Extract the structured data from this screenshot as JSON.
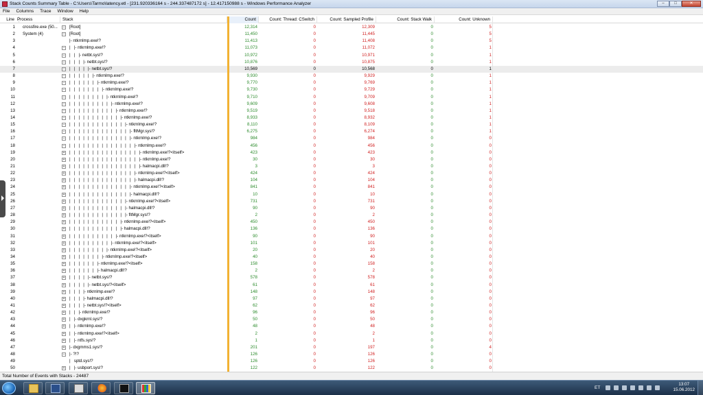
{
  "window": {
    "title": "Stack Counts Summary Table - C:\\Users\\Tarmo\\latency.etl - [231.920336164 s - 244.337487172 s] - 12.417150988 s - Windows Performance Analyzer",
    "minimize": "–",
    "maximize": "□",
    "close": "✕"
  },
  "menu": [
    "File",
    "Columns",
    "Trace",
    "Window",
    "Help"
  ],
  "columns": {
    "line": "Line",
    "process": "Process",
    "stack": "Stack",
    "count": "Count",
    "count_cswitch": "Count: Thread: CSwitch",
    "count_sampled": "Count: Sampled Profile",
    "count_stackwalk": "Count: Stack Walk",
    "count_unknown": "Count: Unknown"
  },
  "rows": [
    {
      "line": "1",
      "proc": "crossfire.exe (50...",
      "exp": "⊟",
      "stack": "[Root]",
      "count": "12,314",
      "cs": "0",
      "sp": "12,309",
      "sw": "0",
      "unk": "5"
    },
    {
      "line": "2",
      "proc": "System (4)",
      "exp": "⊟",
      "stack": "[Root]",
      "count": "11,450",
      "cs": "0",
      "sp": "11,445",
      "sw": "0",
      "unk": "5"
    },
    {
      "line": "3",
      "proc": "",
      "exp": "",
      "stack": "|- ntkrnlmp.exe!?",
      "count": "11,413",
      "cs": "0",
      "sp": "11,408",
      "sw": "0",
      "unk": "5"
    },
    {
      "line": "4",
      "proc": "",
      "exp": "⊟",
      "stack": "|   |- ntkrnlmp.exe!?",
      "count": "11,073",
      "cs": "0",
      "sp": "11,072",
      "sw": "0",
      "unk": "1"
    },
    {
      "line": "5",
      "proc": "",
      "exp": "⊟",
      "stack": "|   |   |- netbt.sys!?",
      "count": "10,972",
      "cs": "0",
      "sp": "10,971",
      "sw": "0",
      "unk": "1"
    },
    {
      "line": "6",
      "proc": "",
      "exp": "⊟",
      "stack": "|   |   |   |- netbt.sys!?",
      "count": "10,876",
      "cs": "0",
      "sp": "10,875",
      "sw": "0",
      "unk": "1"
    },
    {
      "line": "7",
      "proc": "",
      "exp": "⊟",
      "stack": "|   |   |   |   |- netbt.sys!?",
      "count": "10,569",
      "cs": "0",
      "sp": "10,568",
      "sw": "0",
      "unk": "1"
    },
    {
      "line": "8",
      "proc": "",
      "exp": "⊟",
      "stack": "|   |   |   |   |   |- ntkrnlmp.exe!?",
      "count": "9,930",
      "cs": "0",
      "sp": "9,929",
      "sw": "0",
      "unk": "1"
    },
    {
      "line": "9",
      "proc": "",
      "exp": "⊟",
      "stack": "|   |   |   |   |   |   |- ntkrnlmp.exe!?",
      "count": "9,770",
      "cs": "0",
      "sp": "9,769",
      "sw": "0",
      "unk": "1"
    },
    {
      "line": "10",
      "proc": "",
      "exp": "⊟",
      "stack": "|   |   |   |   |   |   |   |- ntkrnlmp.exe!?",
      "count": "9,730",
      "cs": "0",
      "sp": "9,729",
      "sw": "0",
      "unk": "1"
    },
    {
      "line": "11",
      "proc": "",
      "exp": "⊟",
      "stack": "|   |   |   |   |   |   |   |   |- ntkrnlmp.exe!?",
      "count": "9,710",
      "cs": "0",
      "sp": "9,709",
      "sw": "0",
      "unk": "1"
    },
    {
      "line": "12",
      "proc": "",
      "exp": "⊟",
      "stack": "|   |   |   |   |   |   |   |   |   |- ntkrnlmp.exe!?",
      "count": "9,609",
      "cs": "0",
      "sp": "9,608",
      "sw": "0",
      "unk": "1"
    },
    {
      "line": "13",
      "proc": "",
      "exp": "⊟",
      "stack": "|   |   |   |   |   |   |   |   |   |   |- ntkrnlmp.exe!?",
      "count": "9,519",
      "cs": "0",
      "sp": "9,518",
      "sw": "0",
      "unk": "1"
    },
    {
      "line": "14",
      "proc": "",
      "exp": "⊟",
      "stack": "|   |   |   |   |   |   |   |   |   |   |   |- ntkrnlmp.exe!?",
      "count": "8,933",
      "cs": "0",
      "sp": "8,932",
      "sw": "0",
      "unk": "1"
    },
    {
      "line": "15",
      "proc": "",
      "exp": "⊟",
      "stack": "|   |   |   |   |   |   |   |   |   |   |   |   |- ntkrnlmp.exe!?",
      "count": "8,110",
      "cs": "0",
      "sp": "8,109",
      "sw": "0",
      "unk": "1"
    },
    {
      "line": "16",
      "proc": "",
      "exp": "⊟",
      "stack": "|   |   |   |   |   |   |   |   |   |   |   |   |   |- fltMgr.sys!?",
      "count": "6,275",
      "cs": "0",
      "sp": "6,274",
      "sw": "0",
      "unk": "1"
    },
    {
      "line": "17",
      "proc": "",
      "exp": "⊟",
      "stack": "|   |   |   |   |   |   |   |   |   |   |   |   |   |- ntkrnlmp.exe!?",
      "count": "984",
      "cs": "0",
      "sp": "984",
      "sw": "0",
      "unk": "0"
    },
    {
      "line": "18",
      "proc": "",
      "exp": "⊟",
      "stack": "|   |   |   |   |   |   |   |   |   |   |   |   |   |   |- ntkrnlmp.exe!?",
      "count": "456",
      "cs": "0",
      "sp": "456",
      "sw": "0",
      "unk": "0"
    },
    {
      "line": "19",
      "proc": "",
      "exp": "⊞",
      "stack": "|   |   |   |   |   |   |   |   |   |   |   |   |   |   |   |- ntkrnlmp.exe!?<itself>",
      "count": "423",
      "cs": "0",
      "sp": "423",
      "sw": "0",
      "unk": "0"
    },
    {
      "line": "20",
      "proc": "",
      "exp": "⊞",
      "stack": "|   |   |   |   |   |   |   |   |   |   |   |   |   |   |   |- ntkrnlmp.exe!?",
      "count": "30",
      "cs": "0",
      "sp": "30",
      "sw": "0",
      "unk": "0"
    },
    {
      "line": "21",
      "proc": "",
      "exp": "⊞",
      "stack": "|   |   |   |   |   |   |   |   |   |   |   |   |   |   |   |- halmacpi.dll!?",
      "count": "3",
      "cs": "0",
      "sp": "3",
      "sw": "0",
      "unk": "0"
    },
    {
      "line": "22",
      "proc": "",
      "exp": "⊞",
      "stack": "|   |   |   |   |   |   |   |   |   |   |   |   |   |   |- ntkrnlmp.exe!?<itself>",
      "count": "424",
      "cs": "0",
      "sp": "424",
      "sw": "0",
      "unk": "0"
    },
    {
      "line": "23",
      "proc": "",
      "exp": "⊞",
      "stack": "|   |   |   |   |   |   |   |   |   |   |   |   |   |   |- halmacpi.dll!?",
      "count": "104",
      "cs": "0",
      "sp": "104",
      "sw": "0",
      "unk": "0"
    },
    {
      "line": "24",
      "proc": "",
      "exp": "⊞",
      "stack": "|   |   |   |   |   |   |   |   |   |   |   |   |   |- ntkrnlmp.exe!?<itself>",
      "count": "841",
      "cs": "0",
      "sp": "841",
      "sw": "0",
      "unk": "0"
    },
    {
      "line": "25",
      "proc": "",
      "exp": "⊞",
      "stack": "|   |   |   |   |   |   |   |   |   |   |   |   |   |- halmacpi.dll!?",
      "count": "10",
      "cs": "0",
      "sp": "10",
      "sw": "0",
      "unk": "0"
    },
    {
      "line": "26",
      "proc": "",
      "exp": "⊞",
      "stack": "|   |   |   |   |   |   |   |   |   |   |   |   |- ntkrnlmp.exe!?<itself>",
      "count": "731",
      "cs": "0",
      "sp": "731",
      "sw": "0",
      "unk": "0"
    },
    {
      "line": "27",
      "proc": "",
      "exp": "⊞",
      "stack": "|   |   |   |   |   |   |   |   |   |   |   |   |- halmacpi.dll!?",
      "count": "90",
      "cs": "0",
      "sp": "90",
      "sw": "0",
      "unk": "0"
    },
    {
      "line": "28",
      "proc": "",
      "exp": "⊞",
      "stack": "|   |   |   |   |   |   |   |   |   |   |   |   |- fltMgr.sys!?",
      "count": "2",
      "cs": "0",
      "sp": "2",
      "sw": "0",
      "unk": "0"
    },
    {
      "line": "29",
      "proc": "",
      "exp": "⊞",
      "stack": "|   |   |   |   |   |   |   |   |   |   |   |- ntkrnlmp.exe!?<itself>",
      "count": "450",
      "cs": "0",
      "sp": "450",
      "sw": "0",
      "unk": "0"
    },
    {
      "line": "30",
      "proc": "",
      "exp": "⊞",
      "stack": "|   |   |   |   |   |   |   |   |   |   |   |- halmacpi.dll!?",
      "count": "136",
      "cs": "0",
      "sp": "136",
      "sw": "0",
      "unk": "0"
    },
    {
      "line": "31",
      "proc": "",
      "exp": "⊞",
      "stack": "|   |   |   |   |   |   |   |   |   |   |- ntkrnlmp.exe!?<itself>",
      "count": "90",
      "cs": "0",
      "sp": "90",
      "sw": "0",
      "unk": "0"
    },
    {
      "line": "32",
      "proc": "",
      "exp": "⊞",
      "stack": "|   |   |   |   |   |   |   |   |   |- ntkrnlmp.exe!?<itself>",
      "count": "101",
      "cs": "0",
      "sp": "101",
      "sw": "0",
      "unk": "0"
    },
    {
      "line": "33",
      "proc": "",
      "exp": "⊞",
      "stack": "|   |   |   |   |   |   |   |   |- ntkrnlmp.exe!?<itself>",
      "count": "20",
      "cs": "0",
      "sp": "20",
      "sw": "0",
      "unk": "0"
    },
    {
      "line": "34",
      "proc": "",
      "exp": "⊞",
      "stack": "|   |   |   |   |   |   |   |- ntkrnlmp.exe!?<itself>",
      "count": "40",
      "cs": "0",
      "sp": "40",
      "sw": "0",
      "unk": "0"
    },
    {
      "line": "35",
      "proc": "",
      "exp": "⊞",
      "stack": "|   |   |   |   |   |   |- ntkrnlmp.exe!?<itself>",
      "count": "158",
      "cs": "0",
      "sp": "158",
      "sw": "0",
      "unk": "0"
    },
    {
      "line": "36",
      "proc": "",
      "exp": "⊞",
      "stack": "|   |   |   |   |   |   |- halmacpi.dll!?",
      "count": "2",
      "cs": "0",
      "sp": "2",
      "sw": "0",
      "unk": "0"
    },
    {
      "line": "37",
      "proc": "",
      "exp": "⊞",
      "stack": "|   |   |   |   |- netbt.sys!?",
      "count": "578",
      "cs": "0",
      "sp": "578",
      "sw": "0",
      "unk": "0"
    },
    {
      "line": "38",
      "proc": "",
      "exp": "⊞",
      "stack": "|   |   |   |   |- netbt.sys!?<itself>",
      "count": "61",
      "cs": "0",
      "sp": "61",
      "sw": "0",
      "unk": "0"
    },
    {
      "line": "39",
      "proc": "",
      "exp": "⊞",
      "stack": "|   |   |   |- ntkrnlmp.exe!?",
      "count": "148",
      "cs": "0",
      "sp": "148",
      "sw": "0",
      "unk": "0"
    },
    {
      "line": "40",
      "proc": "",
      "exp": "⊞",
      "stack": "|   |   |   |- halmacpi.dll!?",
      "count": "97",
      "cs": "0",
      "sp": "97",
      "sw": "0",
      "unk": "0"
    },
    {
      "line": "41",
      "proc": "",
      "exp": "⊞",
      "stack": "|   |   |   |- netbt.sys!?<itself>",
      "count": "62",
      "cs": "0",
      "sp": "62",
      "sw": "0",
      "unk": "0"
    },
    {
      "line": "42",
      "proc": "",
      "exp": "⊞",
      "stack": "|   |   |- ntkrnlmp.exe!?",
      "count": "96",
      "cs": "0",
      "sp": "96",
      "sw": "0",
      "unk": "0"
    },
    {
      "line": "43",
      "proc": "",
      "exp": "⊞",
      "stack": "|   |- dxgkrnl.sys!?",
      "count": "50",
      "cs": "0",
      "sp": "50",
      "sw": "0",
      "unk": "0"
    },
    {
      "line": "44",
      "proc": "",
      "exp": "⊞",
      "stack": "|   |- ntkrnlmp.exe!?",
      "count": "48",
      "cs": "0",
      "sp": "48",
      "sw": "0",
      "unk": "0"
    },
    {
      "line": "45",
      "proc": "",
      "exp": "⊞",
      "stack": "|   |- ntkrnlmp.exe!?<itself>",
      "count": "2",
      "cs": "0",
      "sp": "2",
      "sw": "0",
      "unk": "0"
    },
    {
      "line": "46",
      "proc": "",
      "exp": "⊞",
      "stack": "|   |- ntfs.sys!?",
      "count": "1",
      "cs": "0",
      "sp": "1",
      "sw": "0",
      "unk": "0"
    },
    {
      "line": "47",
      "proc": "",
      "exp": "⊞",
      "stack": "|- dxgmms1.sys!?",
      "count": "201",
      "cs": "0",
      "sp": "197",
      "sw": "0",
      "unk": "4"
    },
    {
      "line": "48",
      "proc": "",
      "exp": "⊟",
      "stack": "|- ?!?",
      "count": "126",
      "cs": "0",
      "sp": "126",
      "sw": "0",
      "unk": "0"
    },
    {
      "line": "49",
      "proc": "",
      "exp": "",
      "stack": "|   sptd.sys!?",
      "count": "126",
      "cs": "0",
      "sp": "126",
      "sw": "0",
      "unk": "0"
    },
    {
      "line": "50",
      "proc": "",
      "exp": "⊞",
      "stack": "|   |- usbport.sys!?",
      "count": "122",
      "cs": "0",
      "sp": "122",
      "sw": "0",
      "unk": "0"
    }
  ],
  "selected_row": "7",
  "status": "Total Number of Events with Stacks - 24487",
  "taskbar": {
    "lang": "ET",
    "time": "13:07",
    "date": "15.06.2012"
  }
}
